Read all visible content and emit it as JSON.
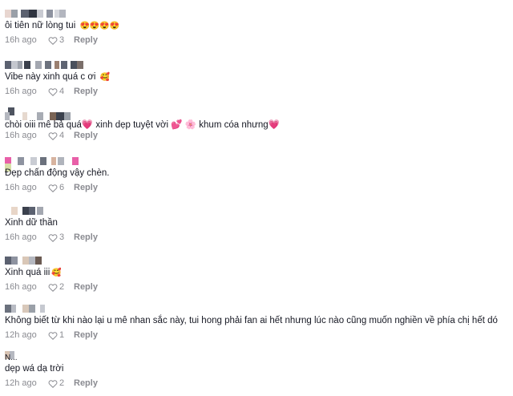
{
  "comments": [
    {
      "username": "",
      "text": "ôi tiên nữ lòng tui",
      "emoji": "😍😍😍😍",
      "time": "16h ago",
      "likes": "3",
      "reply": "Reply"
    },
    {
      "username": "",
      "text": "Vibe này xinh quá c ơi",
      "emoji": "🥰",
      "time": "16h ago",
      "likes": "4",
      "reply": "Reply"
    },
    {
      "username": "",
      "text": "chòi oiii mê bả quá💗 xinh dẹp tuyệt vời 💕 🌸 khum cóa nhưng💗",
      "emoji": "",
      "time": "16h ago",
      "likes": "4",
      "reply": "Reply"
    },
    {
      "username": "",
      "text": "Đẹp chấn động vậy chèn.",
      "emoji": "",
      "time": "16h ago",
      "likes": "6",
      "reply": "Reply"
    },
    {
      "username": "",
      "text": "Xinh dữ thần",
      "emoji": "",
      "time": "16h ago",
      "likes": "3",
      "reply": "Reply"
    },
    {
      "username": "",
      "text": "Xinh quá iii",
      "emoji": "🥰",
      "time": "16h ago",
      "likes": "2",
      "reply": "Reply"
    },
    {
      "username": "",
      "text": "Không biết từ khi nào lại u mê nhan sắc này, tui hong phải fan ai hết nhưng lúc nào cũng muốn nghiền về phía chị hết dó",
      "emoji": "",
      "time": "12h ago",
      "likes": "1",
      "reply": "Reply"
    },
    {
      "username": "N...",
      "text": "dẹp wá dạ trời",
      "emoji": "",
      "time": "12h ago",
      "likes": "2",
      "reply": "Reply"
    }
  ],
  "colors": {
    "meta": "#8a8b91",
    "text": "#161823"
  }
}
